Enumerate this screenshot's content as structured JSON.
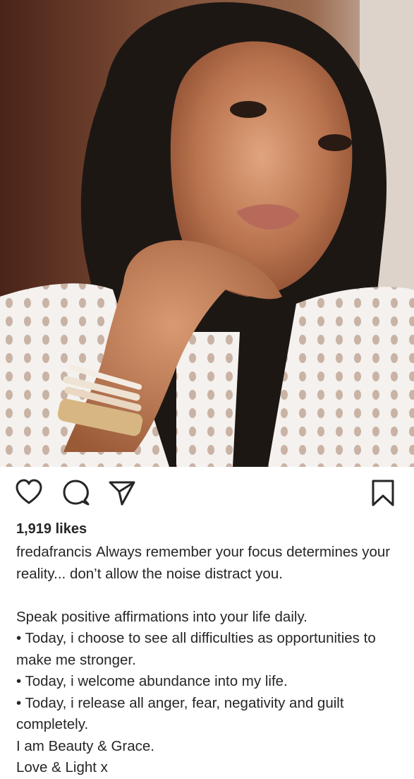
{
  "post": {
    "image_alt_icon": "photo",
    "likes": "1,919 likes",
    "username": "fredafrancis",
    "caption_first": "Always remember your focus determines your reality... don’t allow the noise distract you.",
    "caption_lines": [
      "Speak positive affirmations into your life daily.",
      "• Today, i choose to see all difficulties as opportunities to make me stronger.",
      "• Today, i welcome abundance into my life.",
      "• Today, i release all anger, fear, negativity and guilt completely.",
      "I am Beauty & Grace.",
      "Love & Light x"
    ]
  },
  "actions": {
    "like_icon": "heart-icon",
    "comment_icon": "comment-icon",
    "share_icon": "send-icon",
    "save_icon": "bookmark-icon"
  },
  "colors": {
    "text": "#262626",
    "background": "#ffffff"
  }
}
